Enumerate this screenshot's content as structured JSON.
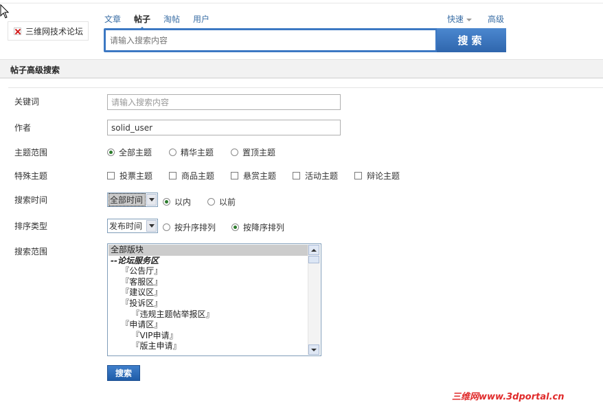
{
  "header": {
    "forum_name": "三维网技术论坛",
    "tabs": [
      {
        "label": "文章",
        "active": false
      },
      {
        "label": "帖子",
        "active": true
      },
      {
        "label": "淘帖",
        "active": false
      },
      {
        "label": "用户",
        "active": false
      }
    ],
    "quick_label": "快速",
    "advanced_label": "高级",
    "search": {
      "placeholder": "请输入搜索内容",
      "value": "",
      "button_label": "搜索"
    }
  },
  "section_title": "帖子高级搜索",
  "form": {
    "keyword": {
      "label": "关键词",
      "placeholder": "请输入搜索内容",
      "value": ""
    },
    "author": {
      "label": "作者",
      "value": "solid_user"
    },
    "topic_scope": {
      "label": "主题范围",
      "options": [
        {
          "label": "全部主题",
          "checked": true
        },
        {
          "label": "精华主题",
          "checked": false
        },
        {
          "label": "置顶主题",
          "checked": false
        }
      ]
    },
    "special_topics": {
      "label": "特殊主题",
      "options": [
        {
          "label": "投票主题",
          "checked": false
        },
        {
          "label": "商品主题",
          "checked": false
        },
        {
          "label": "悬赏主题",
          "checked": false
        },
        {
          "label": "活动主题",
          "checked": false
        },
        {
          "label": "辩论主题",
          "checked": false
        }
      ]
    },
    "search_time": {
      "label": "搜索时间",
      "selected": "全部时间",
      "options": [
        {
          "label": "以内",
          "checked": true
        },
        {
          "label": "以前",
          "checked": false
        }
      ]
    },
    "sort_type": {
      "label": "排序类型",
      "selected": "发布时间",
      "options": [
        {
          "label": "按升序排列",
          "checked": false
        },
        {
          "label": "按降序排列",
          "checked": true
        }
      ]
    },
    "search_scope": {
      "label": "搜索范围",
      "items": [
        {
          "text": "全部版块",
          "selected": true
        },
        {
          "text": "--论坛服务区",
          "category": true
        },
        {
          "text": "    『公告厅』"
        },
        {
          "text": "    『客服区』"
        },
        {
          "text": "    『建议区』"
        },
        {
          "text": "    『投诉区』"
        },
        {
          "text": "        『违规主题帖举报区』"
        },
        {
          "text": "    『申请区』"
        },
        {
          "text": "        『VIP申请』"
        },
        {
          "text": "        『版主申请』"
        }
      ]
    },
    "submit_label": "搜索"
  },
  "watermark": "三维网www.3dportal.cn",
  "colors": {
    "accent_blue": "#3c78c3",
    "link_blue": "#3a6ea5",
    "watermark_red": "#e02a2a"
  }
}
